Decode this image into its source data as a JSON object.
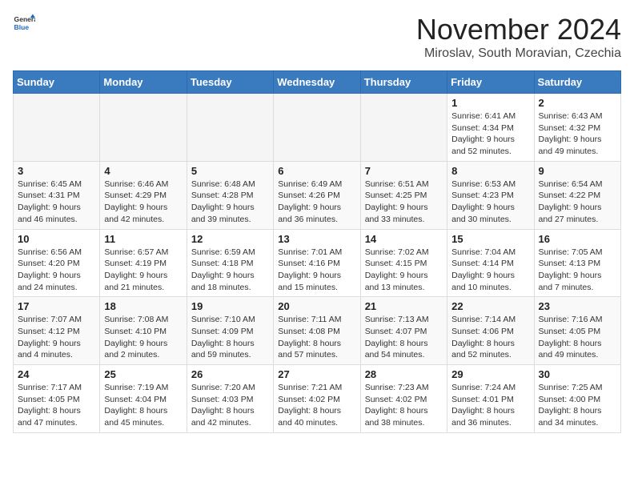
{
  "logo": {
    "general": "General",
    "blue": "Blue"
  },
  "title": "November 2024",
  "subtitle": "Miroslav, South Moravian, Czechia",
  "days_of_week": [
    "Sunday",
    "Monday",
    "Tuesday",
    "Wednesday",
    "Thursday",
    "Friday",
    "Saturday"
  ],
  "weeks": [
    [
      {
        "day": "",
        "info": "",
        "empty": true
      },
      {
        "day": "",
        "info": "",
        "empty": true
      },
      {
        "day": "",
        "info": "",
        "empty": true
      },
      {
        "day": "",
        "info": "",
        "empty": true
      },
      {
        "day": "",
        "info": "",
        "empty": true
      },
      {
        "day": "1",
        "info": "Sunrise: 6:41 AM\nSunset: 4:34 PM\nDaylight: 9 hours\nand 52 minutes."
      },
      {
        "day": "2",
        "info": "Sunrise: 6:43 AM\nSunset: 4:32 PM\nDaylight: 9 hours\nand 49 minutes."
      }
    ],
    [
      {
        "day": "3",
        "info": "Sunrise: 6:45 AM\nSunset: 4:31 PM\nDaylight: 9 hours\nand 46 minutes."
      },
      {
        "day": "4",
        "info": "Sunrise: 6:46 AM\nSunset: 4:29 PM\nDaylight: 9 hours\nand 42 minutes."
      },
      {
        "day": "5",
        "info": "Sunrise: 6:48 AM\nSunset: 4:28 PM\nDaylight: 9 hours\nand 39 minutes."
      },
      {
        "day": "6",
        "info": "Sunrise: 6:49 AM\nSunset: 4:26 PM\nDaylight: 9 hours\nand 36 minutes."
      },
      {
        "day": "7",
        "info": "Sunrise: 6:51 AM\nSunset: 4:25 PM\nDaylight: 9 hours\nand 33 minutes."
      },
      {
        "day": "8",
        "info": "Sunrise: 6:53 AM\nSunset: 4:23 PM\nDaylight: 9 hours\nand 30 minutes."
      },
      {
        "day": "9",
        "info": "Sunrise: 6:54 AM\nSunset: 4:22 PM\nDaylight: 9 hours\nand 27 minutes."
      }
    ],
    [
      {
        "day": "10",
        "info": "Sunrise: 6:56 AM\nSunset: 4:20 PM\nDaylight: 9 hours\nand 24 minutes."
      },
      {
        "day": "11",
        "info": "Sunrise: 6:57 AM\nSunset: 4:19 PM\nDaylight: 9 hours\nand 21 minutes."
      },
      {
        "day": "12",
        "info": "Sunrise: 6:59 AM\nSunset: 4:18 PM\nDaylight: 9 hours\nand 18 minutes."
      },
      {
        "day": "13",
        "info": "Sunrise: 7:01 AM\nSunset: 4:16 PM\nDaylight: 9 hours\nand 15 minutes."
      },
      {
        "day": "14",
        "info": "Sunrise: 7:02 AM\nSunset: 4:15 PM\nDaylight: 9 hours\nand 13 minutes."
      },
      {
        "day": "15",
        "info": "Sunrise: 7:04 AM\nSunset: 4:14 PM\nDaylight: 9 hours\nand 10 minutes."
      },
      {
        "day": "16",
        "info": "Sunrise: 7:05 AM\nSunset: 4:13 PM\nDaylight: 9 hours\nand 7 minutes."
      }
    ],
    [
      {
        "day": "17",
        "info": "Sunrise: 7:07 AM\nSunset: 4:12 PM\nDaylight: 9 hours\nand 4 minutes."
      },
      {
        "day": "18",
        "info": "Sunrise: 7:08 AM\nSunset: 4:10 PM\nDaylight: 9 hours\nand 2 minutes."
      },
      {
        "day": "19",
        "info": "Sunrise: 7:10 AM\nSunset: 4:09 PM\nDaylight: 8 hours\nand 59 minutes."
      },
      {
        "day": "20",
        "info": "Sunrise: 7:11 AM\nSunset: 4:08 PM\nDaylight: 8 hours\nand 57 minutes."
      },
      {
        "day": "21",
        "info": "Sunrise: 7:13 AM\nSunset: 4:07 PM\nDaylight: 8 hours\nand 54 minutes."
      },
      {
        "day": "22",
        "info": "Sunrise: 7:14 AM\nSunset: 4:06 PM\nDaylight: 8 hours\nand 52 minutes."
      },
      {
        "day": "23",
        "info": "Sunrise: 7:16 AM\nSunset: 4:05 PM\nDaylight: 8 hours\nand 49 minutes."
      }
    ],
    [
      {
        "day": "24",
        "info": "Sunrise: 7:17 AM\nSunset: 4:05 PM\nDaylight: 8 hours\nand 47 minutes."
      },
      {
        "day": "25",
        "info": "Sunrise: 7:19 AM\nSunset: 4:04 PM\nDaylight: 8 hours\nand 45 minutes."
      },
      {
        "day": "26",
        "info": "Sunrise: 7:20 AM\nSunset: 4:03 PM\nDaylight: 8 hours\nand 42 minutes."
      },
      {
        "day": "27",
        "info": "Sunrise: 7:21 AM\nSunset: 4:02 PM\nDaylight: 8 hours\nand 40 minutes."
      },
      {
        "day": "28",
        "info": "Sunrise: 7:23 AM\nSunset: 4:02 PM\nDaylight: 8 hours\nand 38 minutes."
      },
      {
        "day": "29",
        "info": "Sunrise: 7:24 AM\nSunset: 4:01 PM\nDaylight: 8 hours\nand 36 minutes."
      },
      {
        "day": "30",
        "info": "Sunrise: 7:25 AM\nSunset: 4:00 PM\nDaylight: 8 hours\nand 34 minutes."
      }
    ]
  ]
}
